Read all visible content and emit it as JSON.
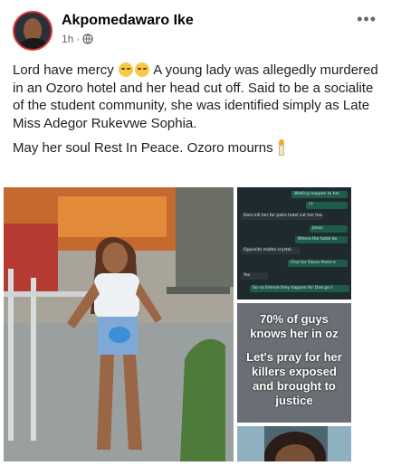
{
  "post": {
    "author": "Akpomedawaro Ike",
    "time": "1h",
    "separator": "·",
    "more_label": "•••",
    "paragraph1_a": "Lord have mercy ",
    "paragraph1_b": " A young lady was  allegedly murdered in an Ozoro hotel and her head cut off. Said to be a socialite of the student community, she was identified simply as Late Miss Adegor Rukevwe Sophia.",
    "paragraph2": "May her soul Rest In Peace. Ozoro mourns"
  },
  "photos": {
    "quote_line1": "70% of guys knows her in oz",
    "quote_line2": "Let's pray for her killers exposed and brought to justice",
    "chat": [
      {
        "text": "Waiting happen to her",
        "side": "out"
      },
      {
        "text": "??",
        "side": "out"
      },
      {
        "text": "Dem kill her for palm hotel cut her head",
        "side": "in"
      },
      {
        "text": "Jesus",
        "side": "out"
      },
      {
        "text": "Where the hotel de",
        "side": "out"
      },
      {
        "text": "Opposite mathe crystal",
        "side": "in"
      },
      {
        "text": "Chai for Ozoro there e",
        "side": "out"
      },
      {
        "text": "Yes",
        "side": "in"
      },
      {
        "text": "So na Emmie they happen for Dad go ii",
        "side": "out"
      }
    ]
  },
  "icons": {
    "globe": "globe-icon",
    "more": "more-options-icon",
    "emoji": "crying-face-emoji",
    "candle": "candle-emoji"
  },
  "colors": {
    "name": "#050505",
    "meta": "#65676b",
    "text": "#1c1e21",
    "chat_bg": "#1f2a2f",
    "chat_out": "#1e5b4b"
  }
}
